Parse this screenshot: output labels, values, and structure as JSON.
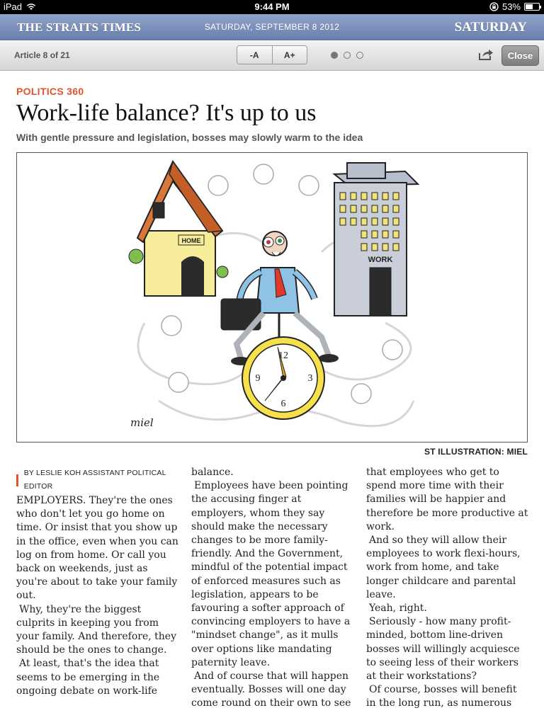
{
  "status_bar": {
    "device": "iPad",
    "time": "9:44 PM",
    "battery": "53%",
    "battery_level": 0.53
  },
  "masthead": {
    "logo": "THE STRAITS TIMES",
    "date": "SATURDAY, SEPTEMBER 8 2012",
    "day": "SATURDAY"
  },
  "toolbar": {
    "article_count": "Article 8 of 21",
    "font_decrease": "-A",
    "font_increase": "A+",
    "page_count": 3,
    "active_page": 1,
    "close_label": "Close"
  },
  "article": {
    "kicker": "POLITICS 360",
    "headline": "Work-life balance? It's up to us",
    "standfirst": "With gentle pressure and legislation, bosses may slowly warm to the idea",
    "illustration": {
      "house_sign": "HOME",
      "office_sign": "WORK",
      "clock_numbers": [
        "12",
        "3",
        "6",
        "9"
      ],
      "signature": "miel"
    },
    "credit": "ST ILLUSTRATION: MIEL",
    "byline": "BY LESLIE KOH ASSISTANT POLITICAL EDITOR",
    "columns": [
      [
        "EMPLOYERS. They're the ones who don't let you go home on time. Or insist that you show up in the office, even when you can log on from home. Or call you back on weekends, just as you're about to take your family out.",
        "Why, they're the biggest culprits in keeping you from your family. And therefore, they should be the ones to change.",
        "At least, that's the idea that seems to be emerging in the ongoing debate on work-life"
      ],
      [
        "balance.",
        "Employees have been pointing the accusing finger at employers, whom they say should make the necessary changes to be more family-friendly. And the Government, mindful of the potential impact of enforced measures such as legislation, appears to be favouring a softer approach of convincing employers to have a \"mindset change\", as it mulls over options like mandating paternity leave.",
        "And of course that will happen eventually. Bosses will one day come round on their own to see"
      ],
      [
        "that employees who get to spend more time with their families will be happier and therefore be more productive at work.",
        "And so they will allow their employees to work flexi-hours, work from home, and take longer childcare and parental leave.",
        "Yeah, right.",
        "Seriously - how many profit-minded, bottom line-driven bosses will willingly acquiesce to seeing less of their workers at their workstations?",
        "Of course, bosses will benefit in the long run, as numerous"
      ]
    ]
  },
  "colors": {
    "masthead": "#7a8dba",
    "kicker": "#e0542a",
    "toolbar": "#e0e0e0"
  }
}
